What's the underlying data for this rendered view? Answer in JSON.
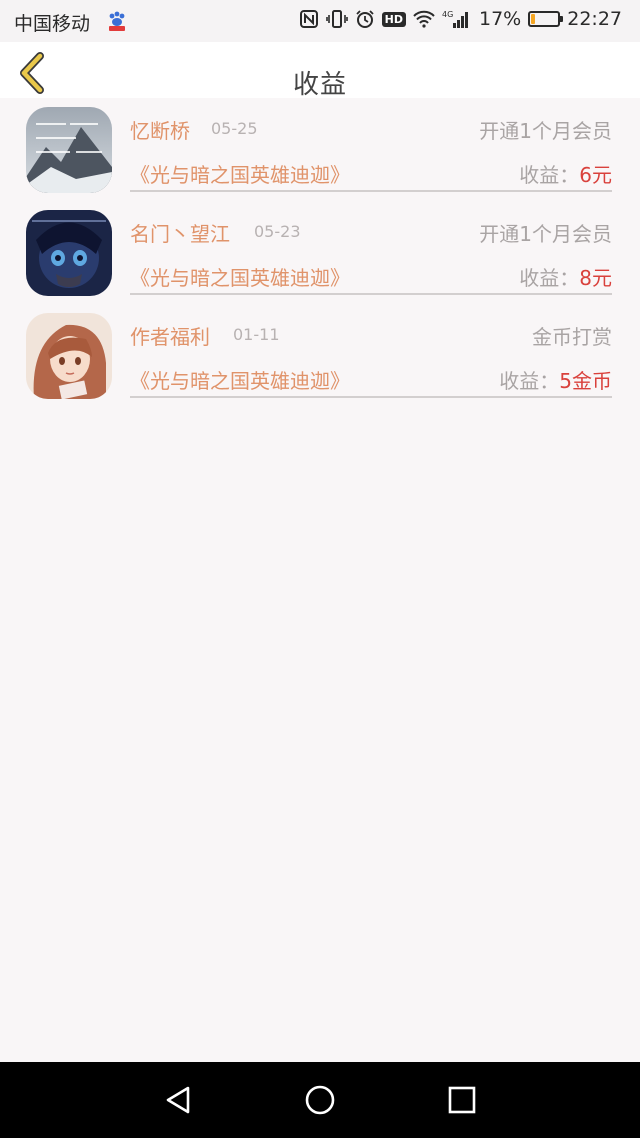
{
  "status_bar": {
    "carrier": "中国移动",
    "network": "4G",
    "battery_text": "17%",
    "battery_level": 0.17,
    "time": "22:27",
    "hd_label": "HD"
  },
  "header": {
    "title": "收益",
    "back_icon": "chevron-left-icon"
  },
  "earnings": [
    {
      "name": "忆断桥",
      "date": "05-25",
      "description": "开通1个月会员",
      "book": "《光与暗之国英雄迪迦》",
      "earn_label": "收益：",
      "earn_value": "6元"
    },
    {
      "name": "名门丶望江",
      "date": "05-23",
      "description": "开通1个月会员",
      "book": "《光与暗之国英雄迪迦》",
      "earn_label": "收益：",
      "earn_value": "8元"
    },
    {
      "name": "作者福利",
      "date": "01-11",
      "description": "金币打赏",
      "book": "《光与暗之国英雄迪迦》",
      "earn_label": "收益：",
      "earn_value": "5金币"
    }
  ],
  "colors": {
    "accent": "#e0936a",
    "value_red": "#d9413c",
    "back_icon": "#e9c84a"
  },
  "nav_bar": {
    "icons": [
      "back-triangle-icon",
      "home-circle-icon",
      "recents-square-icon"
    ]
  }
}
